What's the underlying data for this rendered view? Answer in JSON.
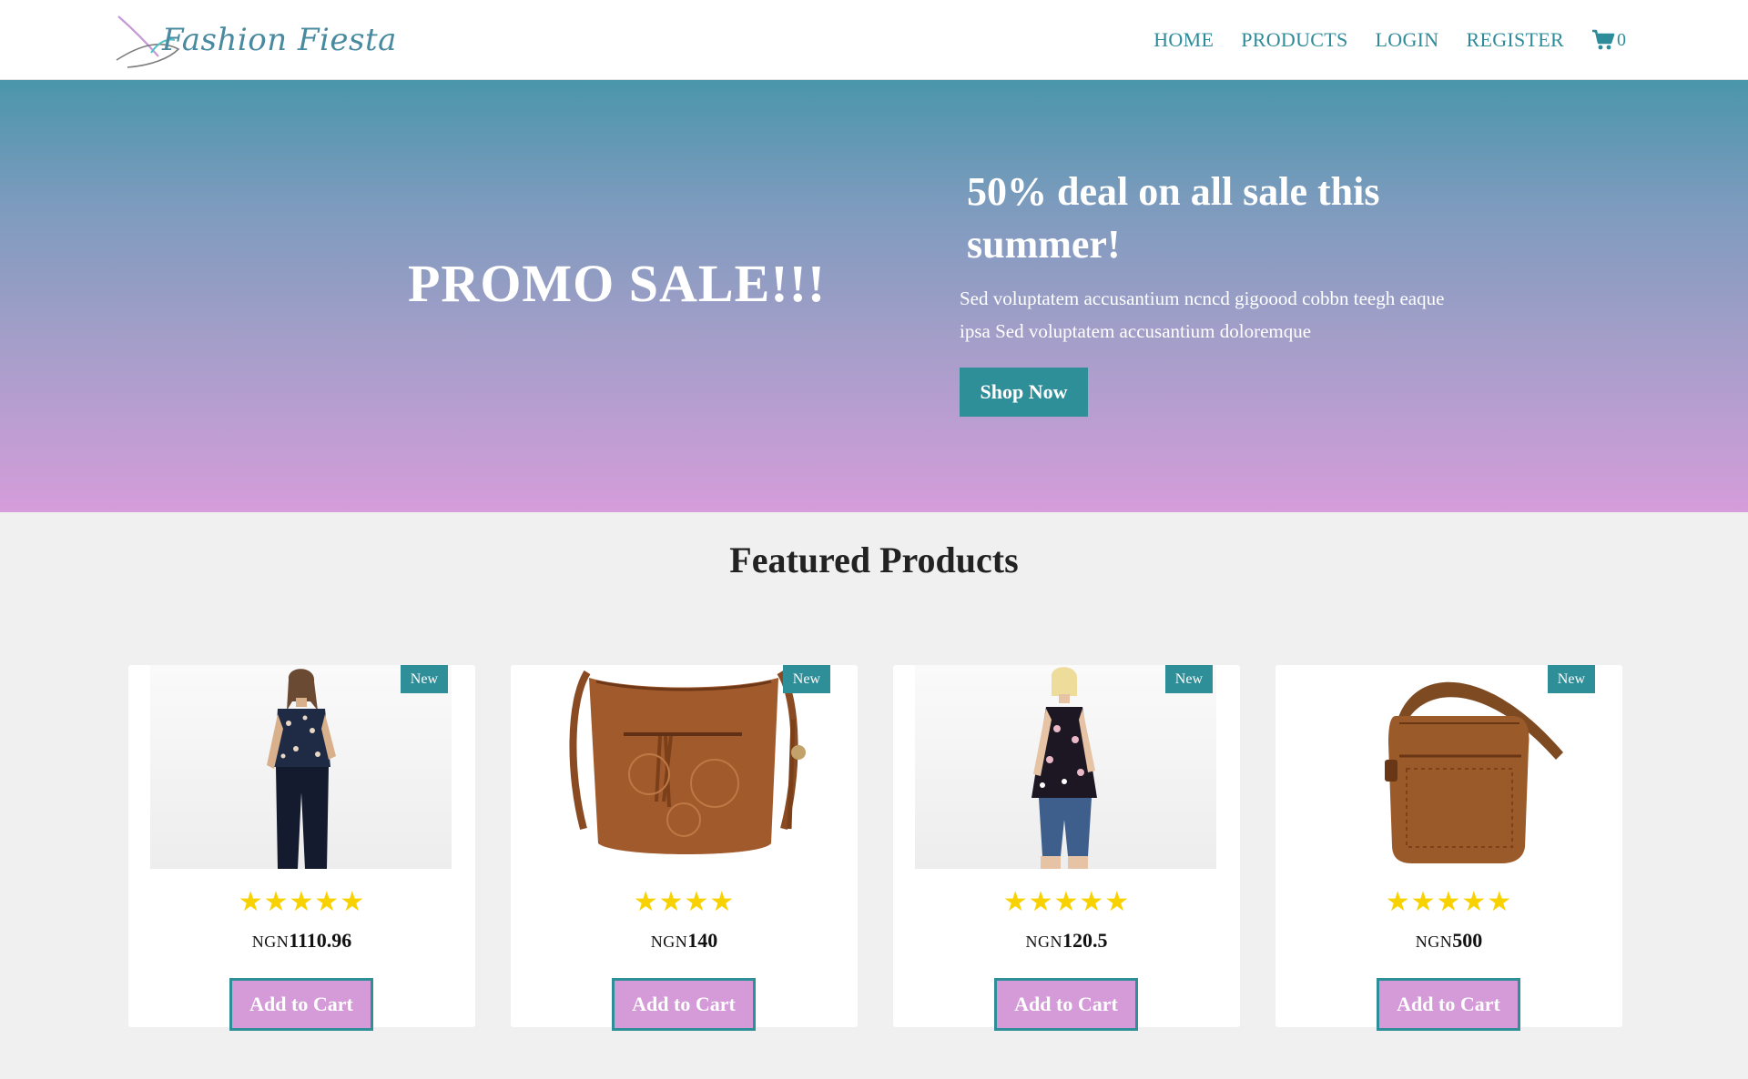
{
  "brand": {
    "name": "Fashion Fiesta",
    "accent": "#2e8f99",
    "pink": "#d49bd8"
  },
  "nav": {
    "items": [
      "HOME",
      "PRODUCTS",
      "LOGIN",
      "REGISTER"
    ],
    "cart_count": "0",
    "cart_icon": "shopping-cart-icon"
  },
  "hero": {
    "promo_title": "PROMO SALE!!!",
    "deal_title": "50% deal on all sale this summer!",
    "deal_text": "Sed voluptatem accusantium ncncd gigoood cobbn teegh eaque ipsa Sed voluptatem accusantium doloremque",
    "button_label": "Shop Now"
  },
  "featured": {
    "title_light": "Featured",
    "title_bold": "Products"
  },
  "products": [
    {
      "badge": "New",
      "image": "woman-floral-top",
      "rating": 5,
      "currency": "NGN",
      "price": "1110.96",
      "button": "Add to Cart"
    },
    {
      "badge": "New",
      "image": "brown-leather-bucket-bag",
      "rating": 4,
      "currency": "NGN",
      "price": "140",
      "button": "Add to Cart"
    },
    {
      "badge": "New",
      "image": "woman-floral-halter-top",
      "rating": 5,
      "currency": "NGN",
      "price": "120.5",
      "button": "Add to Cart"
    },
    {
      "badge": "New",
      "image": "brown-crossbody-bag",
      "rating": 5,
      "currency": "NGN",
      "price": "500",
      "button": "Add to Cart"
    }
  ]
}
